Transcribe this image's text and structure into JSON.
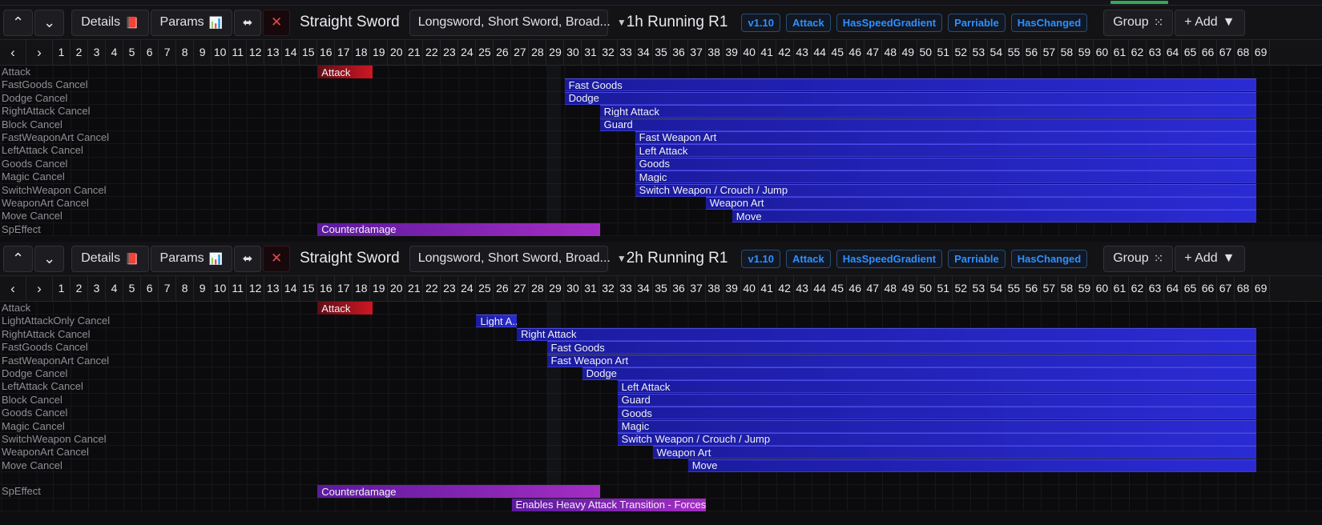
{
  "accent_color": "#35a85a",
  "panels": [
    {
      "toolbar": {
        "up_icon": "chevron-up-icon",
        "down_icon": "chevron-down-icon",
        "details_label": "Details",
        "details_icon": "book-icon",
        "params_label": "Params",
        "params_icon": "chart-icon",
        "collapse_icon": "collapse-icon",
        "close_icon": "close-icon",
        "weapon_class": "Straight Sword",
        "weapon_select_value": "Longsword, Short Sword, Broad...",
        "weapon_select_caret": "chevron-down-icon",
        "animation_title": "1h Running R1",
        "tags": [
          "v1.10",
          "Attack",
          "HasSpeedGradient",
          "Parriable",
          "HasChanged"
        ],
        "group_label": "Group",
        "group_icon": "group-icon",
        "add_label": "+ Add",
        "add_caret": "chevron-down-icon"
      },
      "ruler": {
        "prev_icon": "chevron-left-icon",
        "next_icon": "chevron-right-icon",
        "ticks": [
          1,
          2,
          3,
          4,
          5,
          6,
          7,
          8,
          9,
          10,
          11,
          12,
          13,
          14,
          15,
          16,
          17,
          18,
          19,
          20,
          21,
          22,
          23,
          24,
          25,
          26,
          27,
          28,
          29,
          30,
          31,
          32,
          33,
          34,
          35,
          36,
          37,
          38,
          39,
          40,
          41,
          42,
          43,
          44,
          45,
          46,
          47,
          48,
          49,
          50,
          51,
          52,
          53,
          54,
          55,
          56,
          57,
          58,
          59,
          60,
          61,
          62,
          63,
          64,
          65,
          66,
          67,
          68,
          69
        ]
      },
      "playhead_frame": 29,
      "tracks": [
        {
          "label": "Attack",
          "bars": [
            {
              "text": "Attack",
              "start": 16,
              "end": 19.1,
              "color": "red"
            }
          ]
        },
        {
          "label": "FastGoods Cancel",
          "bars": [
            {
              "text": "Fast Goods",
              "start": 30,
              "end": 69.2,
              "color": "blue"
            }
          ]
        },
        {
          "label": "Dodge Cancel",
          "bars": [
            {
              "text": "Dodge",
              "start": 30,
              "end": 69.2,
              "color": "blue"
            }
          ]
        },
        {
          "label": "RightAttack Cancel",
          "bars": [
            {
              "text": "Right Attack",
              "start": 32,
              "end": 69.2,
              "color": "blue"
            }
          ]
        },
        {
          "label": "Block Cancel",
          "bars": [
            {
              "text": "Guard",
              "start": 32,
              "end": 69.2,
              "color": "blue"
            }
          ]
        },
        {
          "label": "FastWeaponArt Cancel",
          "bars": [
            {
              "text": "Fast Weapon Art",
              "start": 34,
              "end": 69.2,
              "color": "blue"
            }
          ]
        },
        {
          "label": "LeftAttack Cancel",
          "bars": [
            {
              "text": "Left Attack",
              "start": 34,
              "end": 69.2,
              "color": "blue"
            }
          ]
        },
        {
          "label": "Goods Cancel",
          "bars": [
            {
              "text": "Goods",
              "start": 34,
              "end": 69.2,
              "color": "blue"
            }
          ]
        },
        {
          "label": "Magic Cancel",
          "bars": [
            {
              "text": "Magic",
              "start": 34,
              "end": 69.2,
              "color": "blue"
            }
          ]
        },
        {
          "label": "SwitchWeapon Cancel",
          "bars": [
            {
              "text": "Switch Weapon / Crouch / Jump",
              "start": 34,
              "end": 69.2,
              "color": "blue"
            }
          ]
        },
        {
          "label": "WeaponArt Cancel",
          "bars": [
            {
              "text": "Weapon Art",
              "start": 38,
              "end": 69.2,
              "color": "blue"
            }
          ]
        },
        {
          "label": "Move Cancel",
          "bars": [
            {
              "text": "Move",
              "start": 39.5,
              "end": 69.2,
              "color": "blue"
            }
          ]
        },
        {
          "label": "SpEffect",
          "bars": [
            {
              "text": "Counterdamage",
              "start": 16,
              "end": 32,
              "color": "purple"
            }
          ]
        }
      ]
    },
    {
      "toolbar": {
        "up_icon": "chevron-up-icon",
        "down_icon": "chevron-down-icon",
        "details_label": "Details",
        "details_icon": "book-icon",
        "params_label": "Params",
        "params_icon": "chart-icon",
        "collapse_icon": "collapse-icon",
        "close_icon": "close-icon",
        "weapon_class": "Straight Sword",
        "weapon_select_value": "Longsword, Short Sword, Broad...",
        "weapon_select_caret": "chevron-down-icon",
        "animation_title": "2h Running R1",
        "tags": [
          "v1.10",
          "Attack",
          "HasSpeedGradient",
          "Parriable",
          "HasChanged"
        ],
        "group_label": "Group",
        "group_icon": "group-icon",
        "add_label": "+ Add",
        "add_caret": "chevron-down-icon"
      },
      "ruler": {
        "prev_icon": "chevron-left-icon",
        "next_icon": "chevron-right-icon",
        "ticks": [
          1,
          2,
          3,
          4,
          5,
          6,
          7,
          8,
          9,
          10,
          11,
          12,
          13,
          14,
          15,
          16,
          17,
          18,
          19,
          20,
          21,
          22,
          23,
          24,
          25,
          26,
          27,
          28,
          29,
          30,
          31,
          32,
          33,
          34,
          35,
          36,
          37,
          38,
          39,
          40,
          41,
          42,
          43,
          44,
          45,
          46,
          47,
          48,
          49,
          50,
          51,
          52,
          53,
          54,
          55,
          56,
          57,
          58,
          59,
          60,
          61,
          62,
          63,
          64,
          65,
          66,
          67,
          68,
          69
        ]
      },
      "playhead_frame": 29,
      "tracks": [
        {
          "label": "Attack",
          "bars": [
            {
              "text": "Attack",
              "start": 16,
              "end": 19.1,
              "color": "red"
            }
          ]
        },
        {
          "label": "LightAttackOnly Cancel",
          "bars": [
            {
              "text": "Light A...",
              "start": 25,
              "end": 27.3,
              "color": "blue"
            }
          ]
        },
        {
          "label": "RightAttack Cancel",
          "bars": [
            {
              "text": "Right Attack",
              "start": 27.3,
              "end": 69.2,
              "color": "blue"
            }
          ]
        },
        {
          "label": "FastGoods Cancel",
          "bars": [
            {
              "text": "Fast Goods",
              "start": 29,
              "end": 69.2,
              "color": "blue"
            }
          ]
        },
        {
          "label": "FastWeaponArt Cancel",
          "bars": [
            {
              "text": "Fast Weapon Art",
              "start": 29,
              "end": 69.2,
              "color": "blue"
            }
          ]
        },
        {
          "label": "Dodge Cancel",
          "bars": [
            {
              "text": "Dodge",
              "start": 31,
              "end": 69.2,
              "color": "blue"
            }
          ]
        },
        {
          "label": "LeftAttack Cancel",
          "bars": [
            {
              "text": "Left Attack",
              "start": 33,
              "end": 69.2,
              "color": "blue"
            }
          ]
        },
        {
          "label": "Block Cancel",
          "bars": [
            {
              "text": "Guard",
              "start": 33,
              "end": 69.2,
              "color": "blue"
            }
          ]
        },
        {
          "label": "Goods Cancel",
          "bars": [
            {
              "text": "Goods",
              "start": 33,
              "end": 69.2,
              "color": "blue"
            }
          ]
        },
        {
          "label": "Magic Cancel",
          "bars": [
            {
              "text": "Magic",
              "start": 33,
              "end": 69.2,
              "color": "blue"
            }
          ]
        },
        {
          "label": "SwitchWeapon Cancel",
          "bars": [
            {
              "text": "Switch Weapon / Crouch / Jump",
              "start": 33,
              "end": 69.2,
              "color": "blue"
            }
          ]
        },
        {
          "label": "WeaponArt Cancel",
          "bars": [
            {
              "text": "Weapon Art",
              "start": 35,
              "end": 69.2,
              "color": "blue"
            }
          ]
        },
        {
          "label": "Move Cancel",
          "bars": [
            {
              "text": "Move",
              "start": 37,
              "end": 69.2,
              "color": "blue"
            }
          ]
        },
        {
          "label": "",
          "bars": []
        },
        {
          "label": "SpEffect",
          "bars": [
            {
              "text": "Counterdamage",
              "start": 16,
              "end": 32,
              "color": "purple"
            }
          ]
        },
        {
          "label": "",
          "bars": [
            {
              "text": "Enables Heavy Attack Transition - Forces Tr...",
              "start": 27,
              "end": 38,
              "color": "purple"
            }
          ]
        }
      ]
    }
  ]
}
